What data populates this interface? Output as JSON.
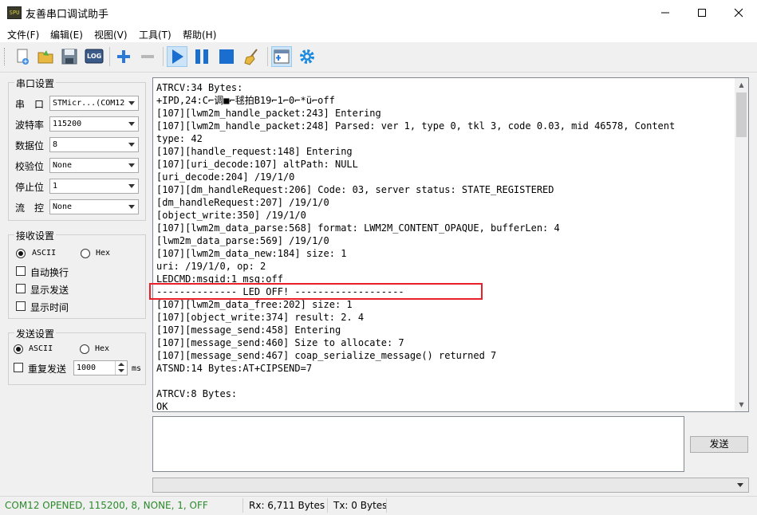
{
  "window": {
    "title": "友善串口调试助手",
    "icon_label": "SPU"
  },
  "menu": [
    "文件(F)",
    "编辑(E)",
    "视图(V)",
    "工具(T)",
    "帮助(H)"
  ],
  "toolbar": {
    "icons": [
      "new-file-icon",
      "open-folder-icon",
      "save-icon",
      "log-icon",
      "add-icon",
      "remove-icon",
      "play-icon",
      "pause-icon",
      "stop-icon",
      "broom-icon",
      "add-panel-icon",
      "gear-icon"
    ],
    "log_label": "LOG"
  },
  "serial_settings": {
    "title": "串口设置",
    "fields": [
      {
        "label": "串　口",
        "value": "STMicr...(COM12"
      },
      {
        "label": "波特率",
        "value": "115200"
      },
      {
        "label": "数据位",
        "value": "8"
      },
      {
        "label": "校验位",
        "value": "None"
      },
      {
        "label": "停止位",
        "value": "1"
      },
      {
        "label": "流　控",
        "value": "None"
      }
    ]
  },
  "receive_settings": {
    "title": "接收设置",
    "ascii": "ASCII",
    "hex": "Hex",
    "checks": [
      "自动换行",
      "显示发送",
      "显示时间"
    ]
  },
  "send_settings": {
    "title": "发送设置",
    "ascii": "ASCII",
    "hex": "Hex",
    "repeat_label": "重复发送",
    "repeat_value": "1000",
    "unit": "ms"
  },
  "terminal_lines": [
    "ATRCV:34 Bytes:",
    "+IPD,24:C⌐调■⌐毬拍B19⌐1⌐0⌐*ü⌐off",
    "[107][lwm2m_handle_packet:243] Entering",
    "[107][lwm2m_handle_packet:248] Parsed: ver 1, type 0, tkl 3, code 0.03, mid 46578, Content",
    "type: 42",
    "[107][handle_request:148] Entering",
    "[107][uri_decode:107] altPath: NULL",
    "[uri_decode:204] /19/1/0",
    "[107][dm_handleRequest:206] Code: 03, server status: STATE_REGISTERED",
    "[dm_handleRequest:207] /19/1/0",
    "[object_write:350] /19/1/0",
    "[107][lwm2m_data_parse:568] format: LWM2M_CONTENT_OPAQUE, bufferLen: 4",
    "[lwm2m_data_parse:569] /19/1/0",
    "[107][lwm2m_data_new:184] size: 1",
    "uri: /19/1/0, op: 2",
    "LEDCMD:msgid:1 msg:off",
    "-------------- LED OFF! -------------------",
    "[107][lwm2m_data_free:202] size: 1",
    "[107][object_write:374] result: 2. 4",
    "[107][message_send:458] Entering",
    "[107][message_send:460] Size to allocate: 7",
    "[107][message_send:467] coap_serialize_message() returned 7",
    "ATSND:14 Bytes:AT+CIPSEND=7",
    "",
    "ATRCV:8 Bytes:",
    "OK"
  ],
  "send_button": "发送",
  "status": {
    "port": "COM12 OPENED, 115200, 8, NONE, 1, OFF",
    "rx": "Rx: 6,711 Bytes",
    "tx": "Tx: 0 Bytes"
  },
  "colors": {
    "status_green": "#2a8a2a",
    "highlight_red": "#e8202a",
    "toolbar_blue": "#1a73c8"
  }
}
